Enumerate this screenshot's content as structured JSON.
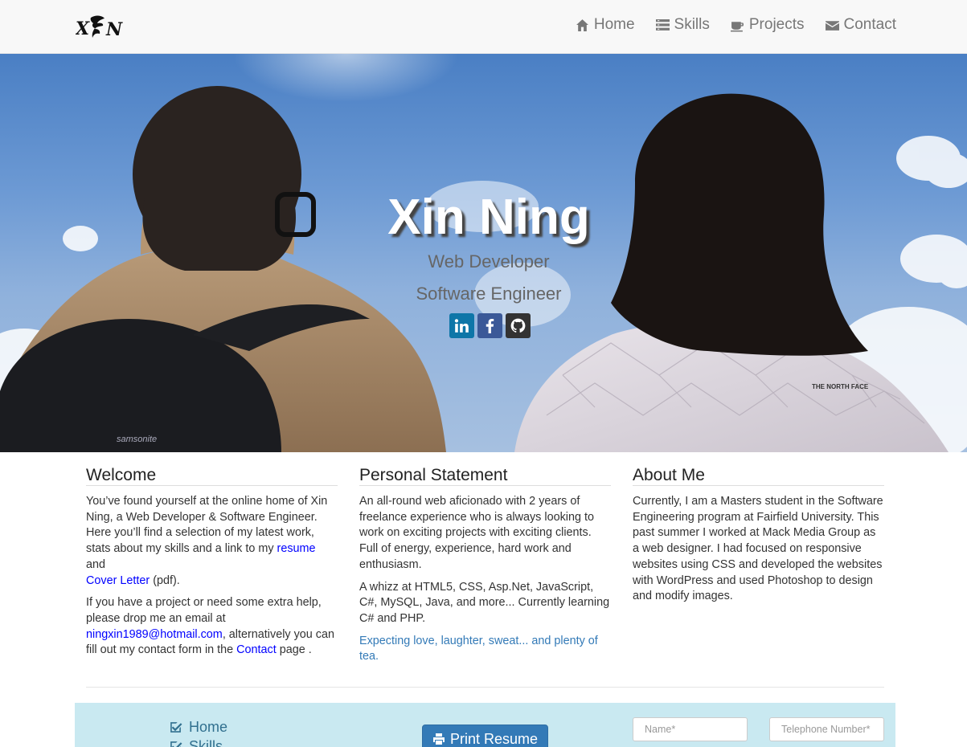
{
  "navbar": {
    "logo_text": "XN",
    "items": [
      {
        "label": "Home",
        "icon": "home-icon"
      },
      {
        "label": "Skills",
        "icon": "list-icon"
      },
      {
        "label": "Projects",
        "icon": "coffee-icon"
      },
      {
        "label": "Contact",
        "icon": "envelope-icon"
      }
    ]
  },
  "hero": {
    "name": "Xin Ning",
    "subtitle1": "Web Developer",
    "subtitle2": "Software Engineer",
    "socials": [
      "linkedin-icon",
      "facebook-icon",
      "github-icon"
    ],
    "bag_brand": "samsonite",
    "jacket_brand": "THE NORTH FACE"
  },
  "welcome": {
    "title": "Welcome",
    "p1_text": "You’ve found yourself at the online home of Xin Ning, a Web Developer & Software Engineer. Here you’ll find a selection of my latest work, stats about my skills and a link to my",
    "p1_link1": "resume",
    "p1_and": "and",
    "p1_link2": "Cover Letter",
    "p1_end": "(pdf).",
    "p2_text": "If you have a project or need some extra help, please drop me an email at",
    "p2_email": "ningxin1989@hotmail.com",
    "p2_mid": ", alternatively you can fill out my contact form in the",
    "p2_link": "Contact",
    "p2_end": "page ."
  },
  "statement": {
    "title": "Personal Statement",
    "p1": "An all-round web aficionado with 2 years of freelance experience who is always looking to work on exciting projects with exciting clients. Full of energy, experience, hard work and enthusiasm.",
    "p2": "A whizz at HTML5, CSS, Asp.Net, JavaScript, C#, MySQL, Java, and more... Currently learning C# and PHP.",
    "quote": "Expecting love, laughter, sweat... and plenty of tea."
  },
  "about": {
    "title": "About Me",
    "p1": "Currently, I am a Masters student in the Software Engineering program at Fairfield University. This past summer I worked at Mack Media Group as a web designer. I had focused on responsive websites using CSS and developed the websites with WordPress and used Photoshop to design and modify images."
  },
  "footer": {
    "links": [
      "Home",
      "Skills"
    ],
    "print_label": "Print Resume",
    "name_placeholder": "Name*",
    "phone_placeholder": "Telephone Number*"
  }
}
